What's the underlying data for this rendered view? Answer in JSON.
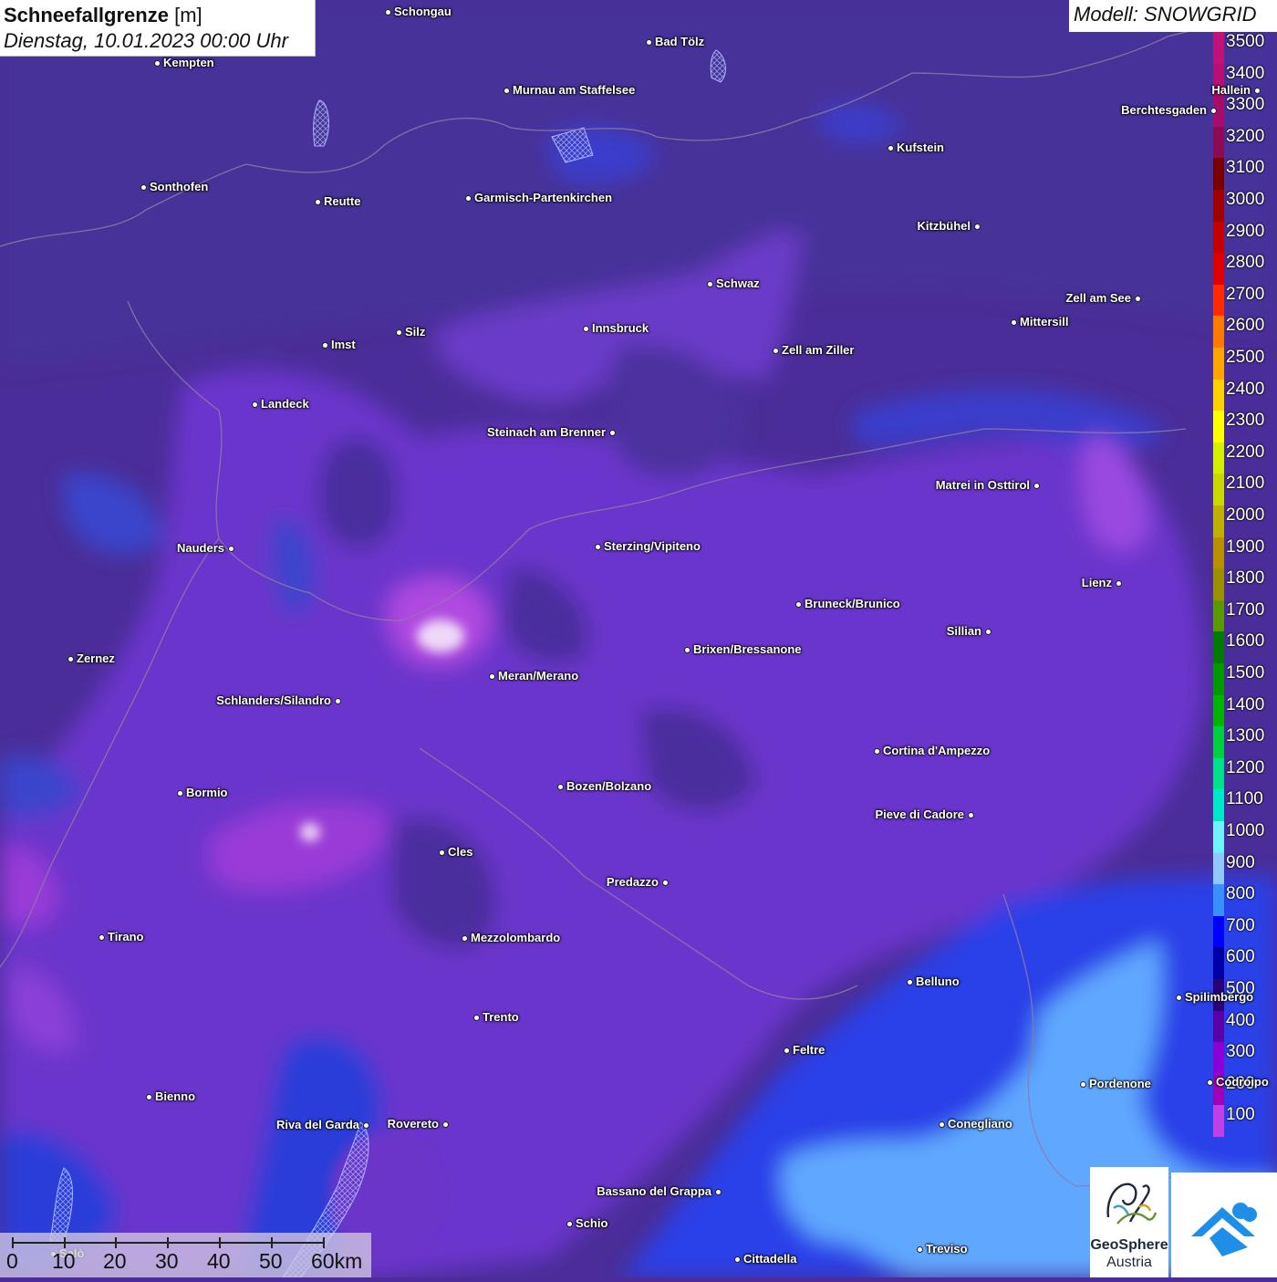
{
  "header": {
    "title_bold": "Schneefallgrenze",
    "title_unit": "[m]",
    "date": "Dienstag, 10.01.2023 00:00 Uhr"
  },
  "model": {
    "label": "Modell: SNOWGRID"
  },
  "legend": {
    "items": [
      {
        "label": "3500",
        "color": "#c2127a"
      },
      {
        "label": "3400",
        "color": "#b80f74"
      },
      {
        "label": "3300",
        "color": "#a80c6b"
      },
      {
        "label": "3200",
        "color": "#8d0a55"
      },
      {
        "label": "3100",
        "color": "#7a0000"
      },
      {
        "label": "3000",
        "color": "#a10000"
      },
      {
        "label": "2900",
        "color": "#c40000"
      },
      {
        "label": "2800",
        "color": "#e00000"
      },
      {
        "label": "2700",
        "color": "#ff2a00"
      },
      {
        "label": "2600",
        "color": "#ff7a00"
      },
      {
        "label": "2500",
        "color": "#ffa500"
      },
      {
        "label": "2400",
        "color": "#ffd000"
      },
      {
        "label": "2300",
        "color": "#ffff00"
      },
      {
        "label": "2200",
        "color": "#d4f000"
      },
      {
        "label": "2100",
        "color": "#c8d800"
      },
      {
        "label": "2000",
        "color": "#c0b000"
      },
      {
        "label": "1900",
        "color": "#b89000"
      },
      {
        "label": "1800",
        "color": "#9a9000"
      },
      {
        "label": "1700",
        "color": "#5a9a00"
      },
      {
        "label": "1600",
        "color": "#007a00"
      },
      {
        "label": "1500",
        "color": "#009a00"
      },
      {
        "label": "1400",
        "color": "#00b400"
      },
      {
        "label": "1300",
        "color": "#00d040"
      },
      {
        "label": "1200",
        "color": "#00e08a"
      },
      {
        "label": "1100",
        "color": "#00e6c8"
      },
      {
        "label": "1000",
        "color": "#6ff2ff"
      },
      {
        "label": "900",
        "color": "#8ec8ff"
      },
      {
        "label": "800",
        "color": "#3a90ff"
      },
      {
        "label": "700",
        "color": "#0000ff"
      },
      {
        "label": "600",
        "color": "#0000a8"
      },
      {
        "label": "500",
        "color": "#2a0078"
      },
      {
        "label": "400",
        "color": "#5a00a8"
      },
      {
        "label": "300",
        "color": "#8a00d8"
      },
      {
        "label": "200",
        "color": "#a000b8"
      },
      {
        "label": "100",
        "color": "#c040e8"
      }
    ]
  },
  "cities": [
    {
      "name": "Schongau"
    },
    {
      "name": "Bad Tölz"
    },
    {
      "name": "Kempten"
    },
    {
      "name": "Murnau am Staffelsee"
    },
    {
      "name": "Hallein"
    },
    {
      "name": "Berchtesgaden"
    },
    {
      "name": "Kufstein"
    },
    {
      "name": "Sonthofen"
    },
    {
      "name": "Reutte"
    },
    {
      "name": "Garmisch-Partenkirchen"
    },
    {
      "name": "Kitzbühel"
    },
    {
      "name": "Schwaz"
    },
    {
      "name": "Zell am See"
    },
    {
      "name": "Innsbruck"
    },
    {
      "name": "Mittersill"
    },
    {
      "name": "Silz"
    },
    {
      "name": "Imst"
    },
    {
      "name": "Zell am Ziller"
    },
    {
      "name": "Landeck"
    },
    {
      "name": "Steinach am Brenner"
    },
    {
      "name": "Matrei in Osttirol"
    },
    {
      "name": "Nauders"
    },
    {
      "name": "Sterzing/Vipiteno"
    },
    {
      "name": "Lienz"
    },
    {
      "name": "Bruneck/Brunico"
    },
    {
      "name": "Sillian"
    },
    {
      "name": "Zernez"
    },
    {
      "name": "Brixen/Bressanone"
    },
    {
      "name": "Meran/Merano"
    },
    {
      "name": "Schlanders/Silandro"
    },
    {
      "name": "Cortina d'Ampezzo"
    },
    {
      "name": "Bozen/Bolzano"
    },
    {
      "name": "Bormio"
    },
    {
      "name": "Pieve di Cadore"
    },
    {
      "name": "Cles"
    },
    {
      "name": "Predazzo"
    },
    {
      "name": "Tirano"
    },
    {
      "name": "Mezzolombardo"
    },
    {
      "name": "Belluno"
    },
    {
      "name": "Spilimbergo"
    },
    {
      "name": "Trento"
    },
    {
      "name": "Feltre"
    },
    {
      "name": "Pordenone"
    },
    {
      "name": "Codroipo"
    },
    {
      "name": "Bienno"
    },
    {
      "name": "Riva del Garda"
    },
    {
      "name": "Rovereto"
    },
    {
      "name": "Conegliano"
    },
    {
      "name": "Bassano del Grappa"
    },
    {
      "name": "Schio"
    },
    {
      "name": "Salò"
    },
    {
      "name": "Treviso"
    },
    {
      "name": "Cittadella"
    }
  ],
  "scalebar": {
    "labels": [
      "0",
      "10",
      "20",
      "30",
      "40",
      "50",
      "60km"
    ]
  },
  "logos": {
    "geo_name": "GeoSphere",
    "geo_sub": "Austria"
  }
}
